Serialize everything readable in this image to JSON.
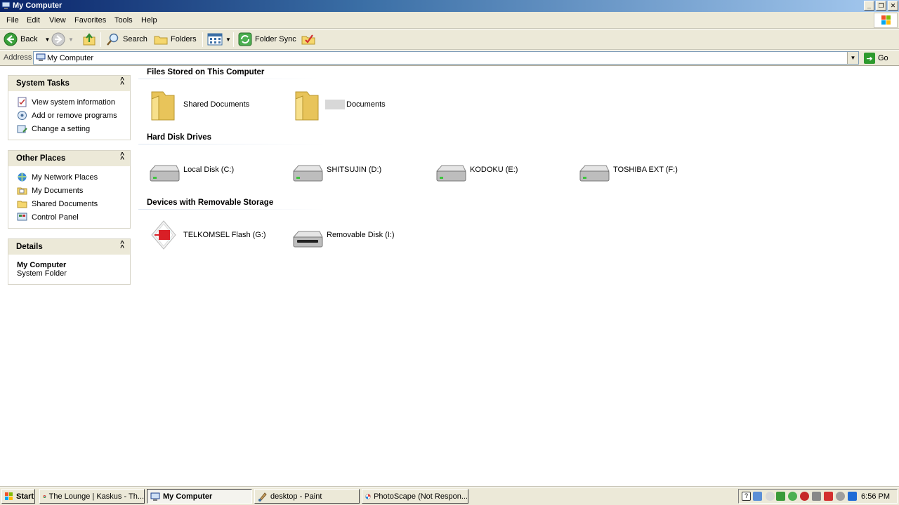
{
  "window": {
    "title": "My Computer"
  },
  "menu": [
    "File",
    "Edit",
    "View",
    "Favorites",
    "Tools",
    "Help"
  ],
  "toolbar": {
    "back_label": "Back",
    "search_label": "Search",
    "folders_label": "Folders",
    "folder_sync_label": "Folder Sync"
  },
  "address": {
    "label": "Address",
    "value": "My Computer",
    "go_label": "Go"
  },
  "sidebar": {
    "system_tasks": {
      "title": "System Tasks",
      "items": [
        "View system information",
        "Add or remove programs",
        "Change a setting"
      ]
    },
    "other_places": {
      "title": "Other Places",
      "items": [
        "My Network Places",
        "My Documents",
        "Shared Documents",
        "Control Panel"
      ]
    },
    "details": {
      "title": "Details",
      "name": "My Computer",
      "type": "System Folder"
    }
  },
  "content": {
    "files_stored": {
      "heading": "Files Stored on This Computer",
      "items": [
        "Shared Documents",
        "Documents"
      ]
    },
    "hard_disks": {
      "heading": "Hard Disk Drives",
      "items": [
        "Local Disk (C:)",
        "SHITSUJIN (D:)",
        "KODOKU (E:)",
        "TOSHIBA EXT (F:)"
      ]
    },
    "removable": {
      "heading": "Devices with Removable Storage",
      "items": [
        "TELKOMSEL Flash (G:)",
        "Removable Disk (I:)"
      ]
    }
  },
  "taskbar": {
    "start_label": "Start",
    "tasks": [
      {
        "label": "The Lounge | Kaskus - Th...",
        "icon": "chrome-icon"
      },
      {
        "label": "My Computer",
        "icon": "my-computer-icon",
        "active": true
      },
      {
        "label": "desktop - Paint",
        "icon": "paint-icon"
      },
      {
        "label": "PhotoScape (Not Respon...",
        "icon": "photoscape-icon"
      }
    ],
    "clock": "6:56 PM"
  },
  "colors": {
    "titlebar_start": "#0a246a",
    "titlebar_end": "#a6caf0",
    "chrome_bg": "#ece9d8",
    "accent_green": "#2e9a2e"
  }
}
